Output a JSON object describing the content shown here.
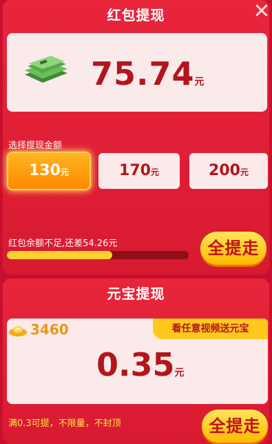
{
  "redpacket": {
    "title": "红包提现",
    "balance": "75.74",
    "unit": "元",
    "choose_label": "选择提现金额",
    "options": [
      {
        "amount": "130",
        "unit": "元",
        "selected": true
      },
      {
        "amount": "170",
        "unit": "元",
        "selected": false
      },
      {
        "amount": "200",
        "unit": "元",
        "selected": false
      }
    ],
    "shortfall_text": "红包余额不足,还差54.26元",
    "progress_fraction": 0.58,
    "withdraw_all_label": "全提走"
  },
  "yuanbao": {
    "title": "元宝提现",
    "ingot_count": "3460",
    "promo_label": "看任意视频送元宝",
    "amount": "0.35",
    "unit": "元",
    "rule_text": "满0.3可提，不限量，不封顶",
    "withdraw_all_label": "全提走"
  },
  "colors": {
    "accent": "#b3151c",
    "gold": "#ffc81e",
    "panel": "#e8253b"
  }
}
